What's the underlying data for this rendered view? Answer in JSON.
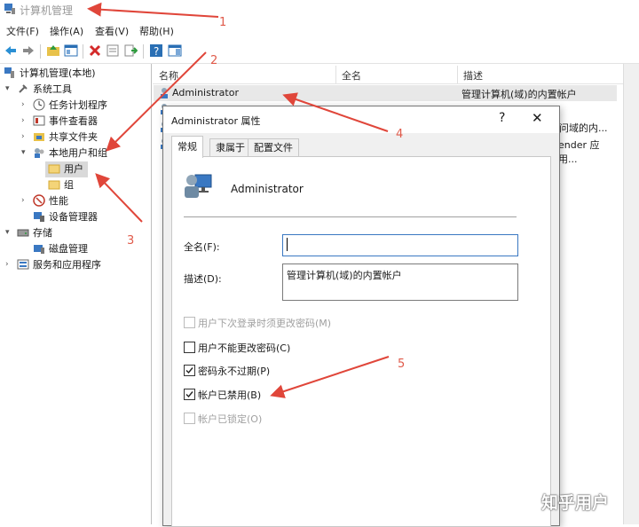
{
  "window": {
    "title": "计算机管理"
  },
  "menu": [
    "文件(F)",
    "操作(A)",
    "查看(V)",
    "帮助(H)"
  ],
  "tree": {
    "root": "计算机管理(本地)",
    "system_tools": "系统工具",
    "task_scheduler": "任务计划程序",
    "event_viewer": "事件查看器",
    "shared_folders": "共享文件夹",
    "local_users_groups": "本地用户和组",
    "users": "用户",
    "groups": "组",
    "performance": "性能",
    "device_manager": "设备管理器",
    "storage": "存储",
    "disk_management": "磁盘管理",
    "services_apps": "服务和应用程序"
  },
  "list": {
    "columns": [
      "名称",
      "全名",
      "描述"
    ],
    "rows": [
      {
        "name": "Administrator",
        "fullname": "",
        "desc": "管理计算机(域)的内置帐户"
      },
      {
        "name": "",
        "fullname": "",
        "desc": ""
      },
      {
        "name": "",
        "fullname": "",
        "desc": "问域的内..."
      },
      {
        "name": "",
        "fullname": "",
        "desc": "ender 应用..."
      }
    ]
  },
  "dialog": {
    "title": "Administrator 属性",
    "help": "?",
    "close": "✕",
    "tabs": [
      "常规",
      "隶属于",
      "配置文件"
    ],
    "username": "Administrator",
    "fullname_label": "全名(F):",
    "fullname_value": "",
    "desc_label": "描述(D):",
    "desc_value": "管理计算机(域)的内置帐户",
    "checkboxes": [
      {
        "label": "用户下次登录时须更改密码(M)",
        "checked": false,
        "disabled": true
      },
      {
        "label": "用户不能更改密码(C)",
        "checked": false,
        "disabled": false
      },
      {
        "label": "密码永不过期(P)",
        "checked": true,
        "disabled": false
      },
      {
        "label": "帐户已禁用(B)",
        "checked": true,
        "disabled": false
      },
      {
        "label": "帐户已锁定(O)",
        "checked": false,
        "disabled": true
      }
    ]
  },
  "annotations": [
    "1",
    "2",
    "3",
    "4",
    "5"
  ],
  "watermark": "知乎用户",
  "colors": {
    "arrow": "#e0463a",
    "selection": "#d9d9d9"
  }
}
